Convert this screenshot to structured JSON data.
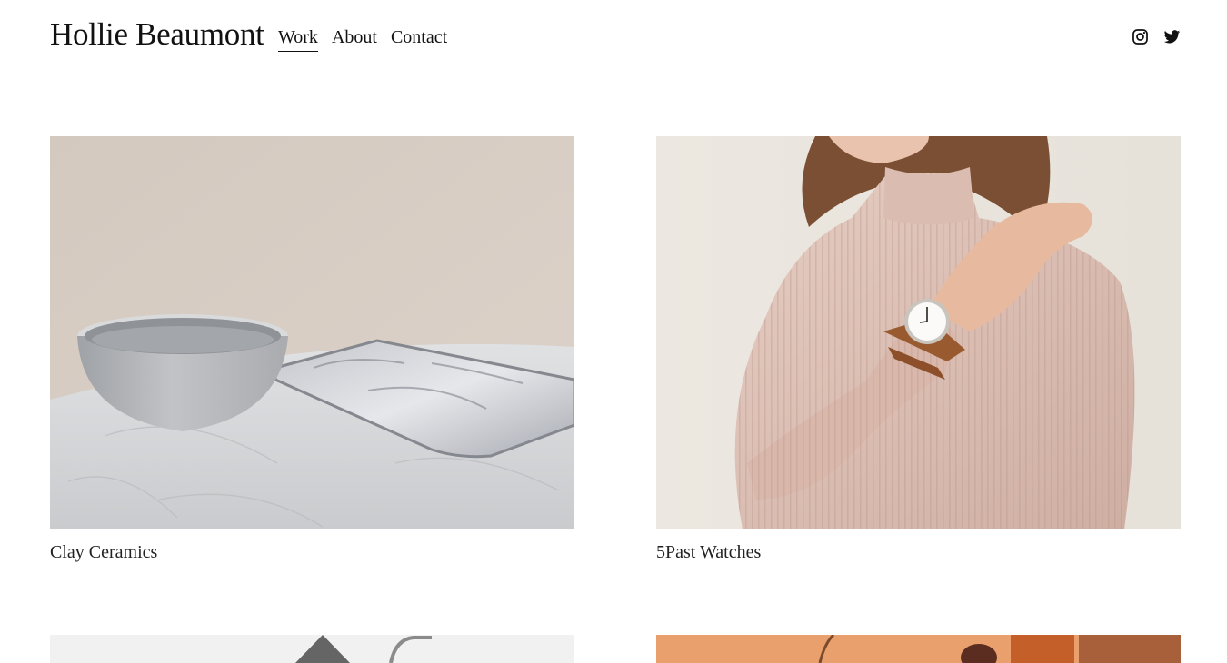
{
  "site": {
    "title": "Hollie Beaumont"
  },
  "nav": {
    "items": [
      {
        "label": "Work",
        "active": true
      },
      {
        "label": "About",
        "active": false
      },
      {
        "label": "Contact",
        "active": false
      }
    ]
  },
  "social": {
    "icons": [
      "instagram-icon",
      "twitter-icon"
    ]
  },
  "projects": [
    {
      "title": "Clay Ceramics"
    },
    {
      "title": "5Past Watches"
    }
  ],
  "colors": {
    "text": "#111111",
    "background": "#ffffff",
    "wall_beige": "#d7cdc3",
    "sweater_pink": "#e2c6bb",
    "watch_strap": "#9a5a30"
  }
}
